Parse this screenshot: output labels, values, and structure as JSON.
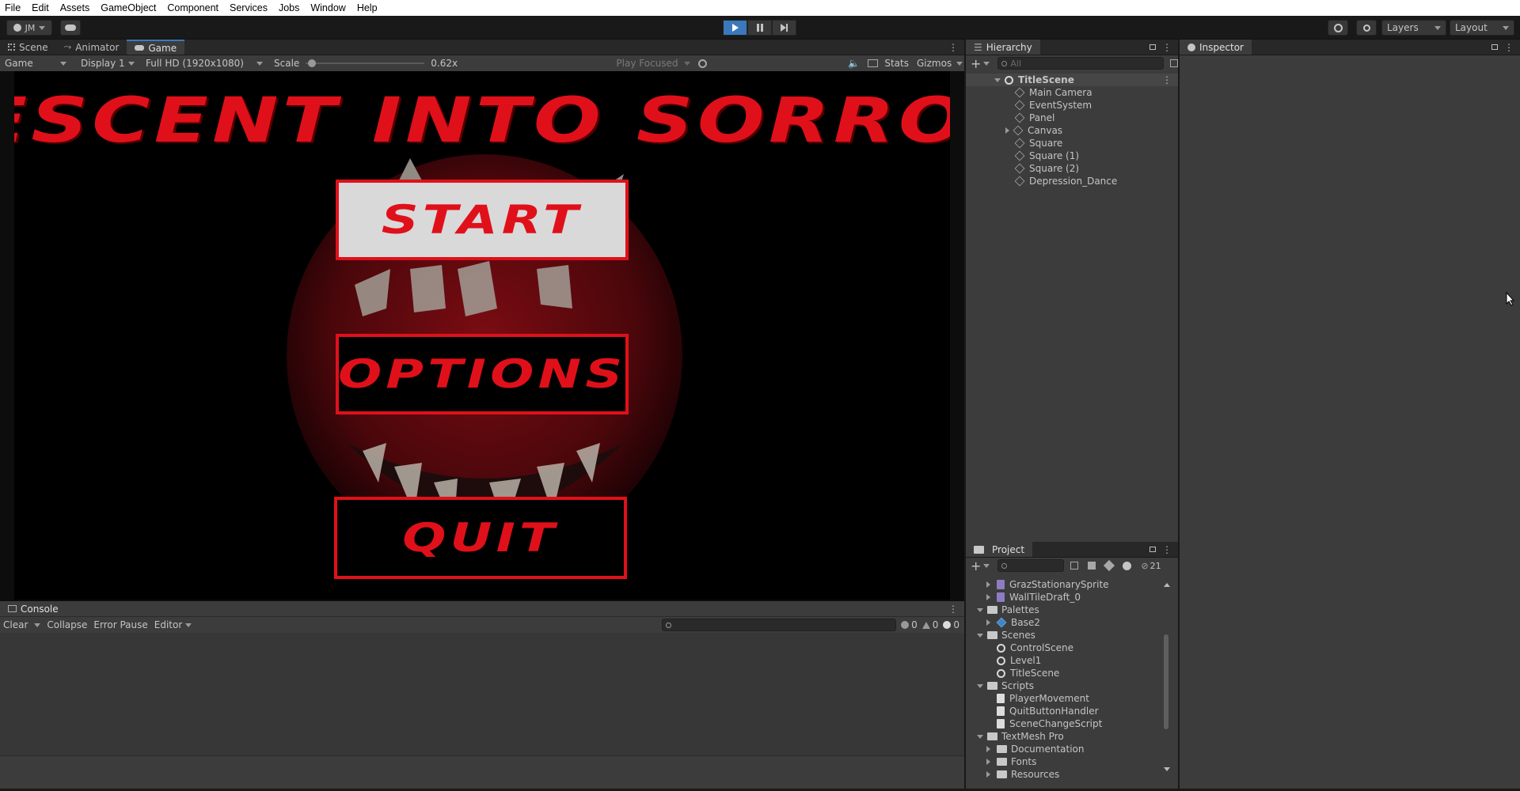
{
  "menubar": [
    "File",
    "Edit",
    "Assets",
    "GameObject",
    "Component",
    "Services",
    "Jobs",
    "Window",
    "Help"
  ],
  "toolbar": {
    "account": "JM",
    "layers": "Layers",
    "layout": "Layout"
  },
  "game_panel": {
    "tabs": [
      "Scene",
      "Animator",
      "Game"
    ],
    "active_tab": "Game",
    "mode": "Game",
    "display": "Display 1",
    "resolution": "Full HD (1920x1080)",
    "scale_label": "Scale",
    "scale_value": "0.62x",
    "play_focused": "Play Focused",
    "stats": "Stats",
    "gizmos": "Gizmos",
    "scale_fraction": 0.02
  },
  "game": {
    "title": "DESCENT INTO SORROW",
    "buttons": [
      "START",
      "OPTIONS",
      "QUIT"
    ],
    "accent": "#e0101a",
    "start_bg": "#d9d9d9"
  },
  "hierarchy": {
    "title": "Hierarchy",
    "search_placeholder": "All",
    "scene": "TitleScene",
    "items": [
      "Main Camera",
      "EventSystem",
      "Panel",
      "Canvas",
      "Square",
      "Square (1)",
      "Square (2)",
      "Depression_Dance"
    ]
  },
  "inspector": {
    "title": "Inspector"
  },
  "console": {
    "title": "Console",
    "clear": "Clear",
    "collapse": "Collapse",
    "error_pause": "Error Pause",
    "editor": "Editor",
    "log_count": "0",
    "warn_count": "0",
    "error_count": "0"
  },
  "project": {
    "title": "Project",
    "hidden_count": "21",
    "rows": [
      {
        "label": "GrazStationarySprite",
        "indent": 2,
        "kind": "sprite"
      },
      {
        "label": "WallTileDraft_0",
        "indent": 2,
        "kind": "sprite"
      },
      {
        "label": "Palettes",
        "indent": 1,
        "kind": "folder-open"
      },
      {
        "label": "Base2",
        "indent": 2,
        "kind": "prefab"
      },
      {
        "label": "Scenes",
        "indent": 1,
        "kind": "folder-open"
      },
      {
        "label": "ControlScene",
        "indent": 2,
        "kind": "scene"
      },
      {
        "label": "Level1",
        "indent": 2,
        "kind": "scene"
      },
      {
        "label": "TitleScene",
        "indent": 2,
        "kind": "scene"
      },
      {
        "label": "Scripts",
        "indent": 1,
        "kind": "folder-open"
      },
      {
        "label": "PlayerMovement",
        "indent": 2,
        "kind": "script"
      },
      {
        "label": "QuitButtonHandler",
        "indent": 2,
        "kind": "script"
      },
      {
        "label": "SceneChangeScript",
        "indent": 2,
        "kind": "script"
      },
      {
        "label": "TextMesh Pro",
        "indent": 1,
        "kind": "folder-open"
      },
      {
        "label": "Documentation",
        "indent": 2,
        "kind": "folder"
      },
      {
        "label": "Fonts",
        "indent": 2,
        "kind": "folder"
      },
      {
        "label": "Resources",
        "indent": 2,
        "kind": "folder"
      }
    ]
  }
}
